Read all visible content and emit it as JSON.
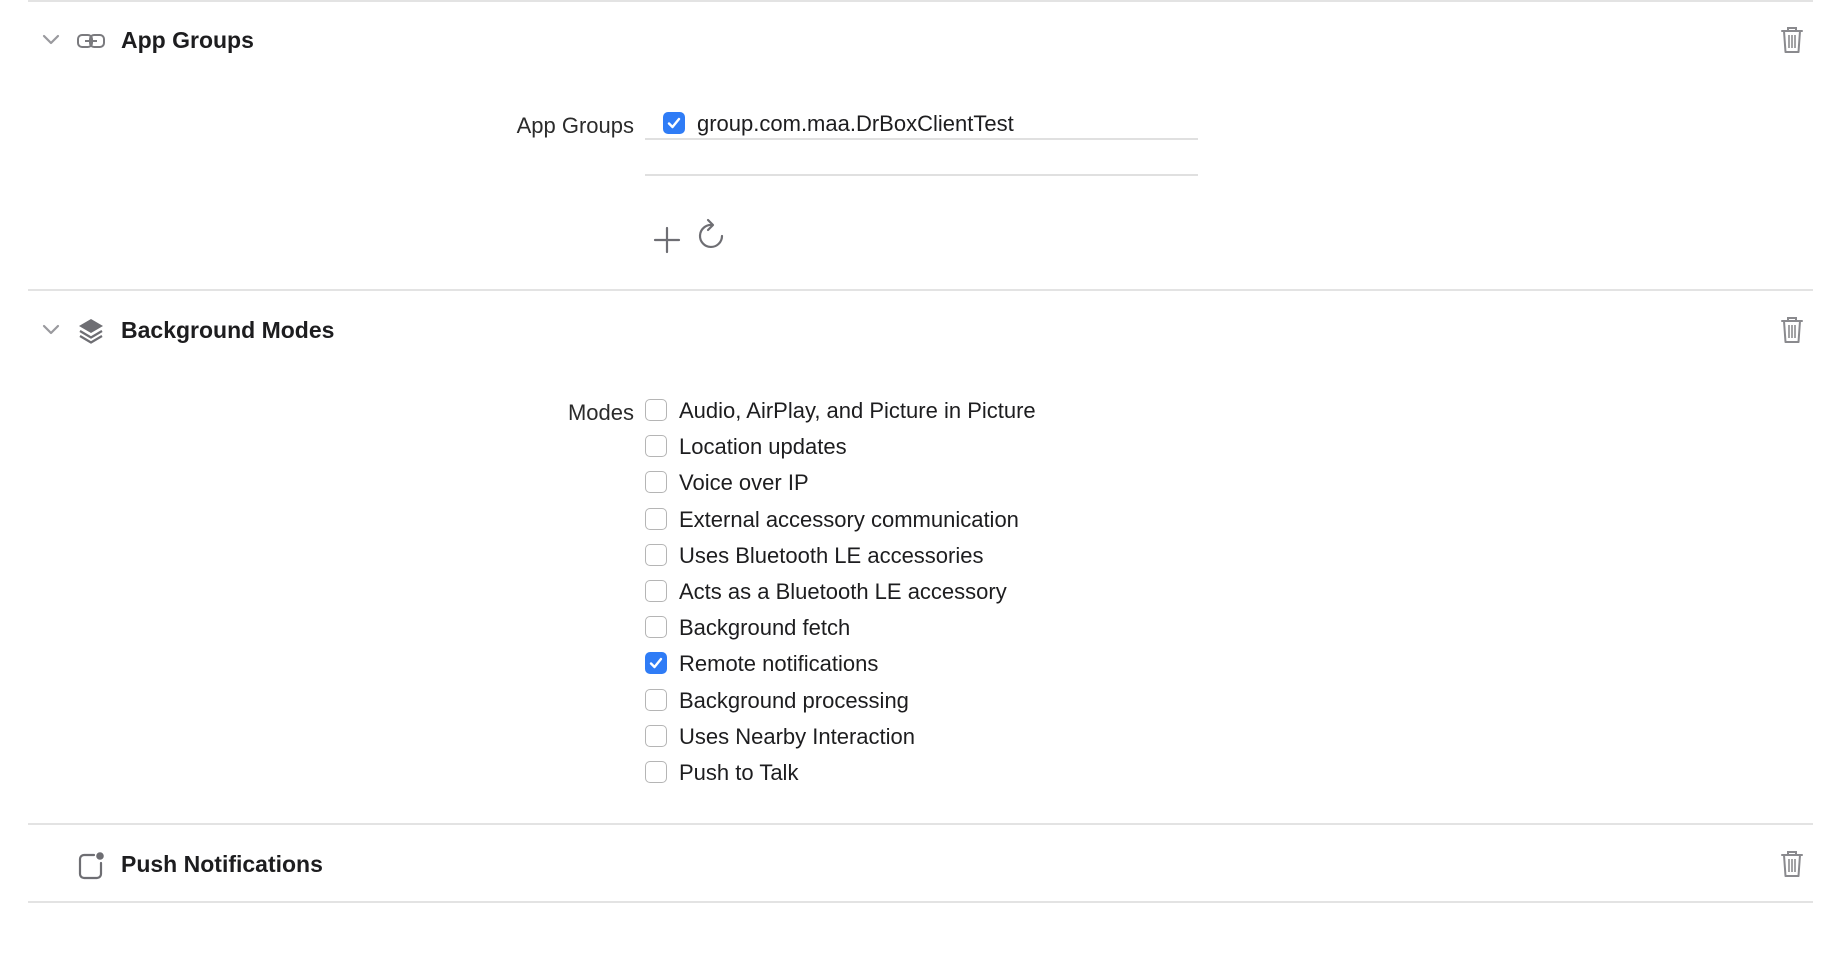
{
  "app_groups": {
    "title": "App Groups",
    "icon": "link-icon",
    "field_label": "App Groups",
    "groups": [
      {
        "name": "group.com.maa.DrBoxClientTest",
        "checked": true
      }
    ]
  },
  "background_modes": {
    "title": "Background Modes",
    "icon": "layers-icon",
    "field_label": "Modes",
    "modes": [
      {
        "label": "Audio, AirPlay, and Picture in Picture",
        "checked": false
      },
      {
        "label": "Location updates",
        "checked": false
      },
      {
        "label": "Voice over IP",
        "checked": false
      },
      {
        "label": "External accessory communication",
        "checked": false
      },
      {
        "label": "Uses Bluetooth LE accessories",
        "checked": false
      },
      {
        "label": "Acts as a Bluetooth LE accessory",
        "checked": false
      },
      {
        "label": "Background fetch",
        "checked": false
      },
      {
        "label": "Remote notifications",
        "checked": true
      },
      {
        "label": "Background processing",
        "checked": false
      },
      {
        "label": "Uses Nearby Interaction",
        "checked": false
      },
      {
        "label": "Push to Talk",
        "checked": false
      }
    ]
  },
  "push_notifications": {
    "title": "Push Notifications",
    "icon": "notification-badge-icon"
  },
  "colors": {
    "accent": "#2f7cf6",
    "divider": "#e3e3e3",
    "icon_gray": "#8a8a8e"
  }
}
